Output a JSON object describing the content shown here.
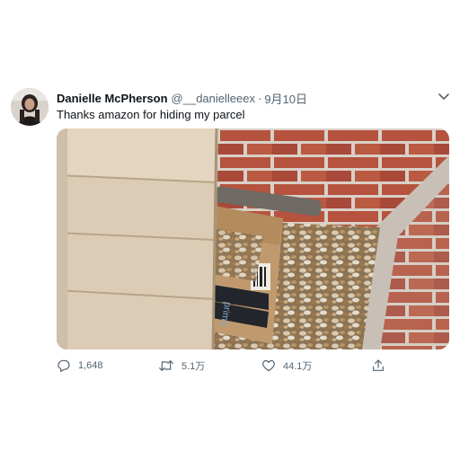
{
  "tweet": {
    "display_name": "Danielle McPherson",
    "handle": "@__danielleeex",
    "separator": "·",
    "date": "9月10日",
    "text": "Thanks amazon for hiding my parcel"
  },
  "media": {
    "box_brand": "prime"
  },
  "actions": {
    "reply_count": "1,648",
    "retweet_count": "5.1万",
    "like_count": "44.1万"
  },
  "icons": [
    "chevron-down-icon",
    "reply-icon",
    "retweet-icon",
    "like-icon",
    "share-icon"
  ]
}
